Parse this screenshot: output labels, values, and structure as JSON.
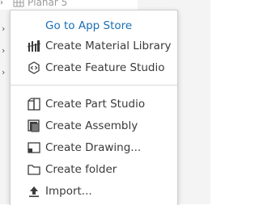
{
  "background_row": {
    "label": "Planar 5",
    "chevron_icon": "chevron-right-icon",
    "icon": "part-studio-grid-icon"
  },
  "menu": {
    "store_link": "Go to App Store",
    "items_top": [
      {
        "label": "Create Material Library",
        "icon": "material-library-icon"
      },
      {
        "label": "Create Feature Studio",
        "icon": "feature-studio-icon"
      }
    ],
    "items_bottom": [
      {
        "label": "Create Part Studio",
        "icon": "part-studio-icon"
      },
      {
        "label": "Create Assembly",
        "icon": "assembly-icon"
      },
      {
        "label": "Create Drawing...",
        "icon": "drawing-icon"
      },
      {
        "label": "Create folder",
        "icon": "folder-icon"
      },
      {
        "label": "Import...",
        "icon": "import-icon"
      }
    ]
  },
  "colors": {
    "link": "#1a6fb5",
    "text": "#3b3b3b",
    "separator": "#d9d9d9"
  }
}
